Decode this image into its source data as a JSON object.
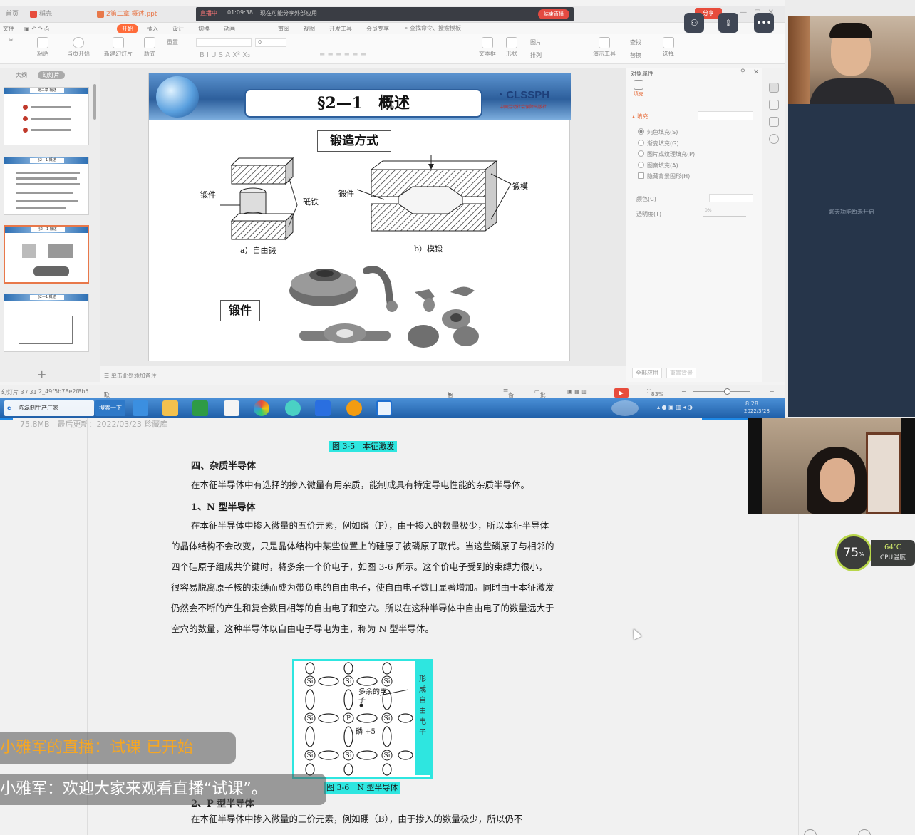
{
  "wps": {
    "tabs": [
      {
        "label": "首页"
      },
      {
        "label": "稻壳"
      },
      {
        "label": "2第二章 概述.ppt"
      }
    ],
    "recording": {
      "status": "直播中",
      "time": "01:09:38",
      "msg": "现在可能分享外部应用",
      "end_label": "结束直播"
    },
    "share_label": "分享",
    "menus": [
      "文件",
      "开始",
      "插入",
      "设计",
      "切换",
      "动画",
      "审阅",
      "视图",
      "开发工具",
      "会员专享"
    ],
    "search_cmd": "查找命令、搜索模板",
    "ribbon": {
      "paste": "粘贴",
      "from_start": "当页开始",
      "new_slide": "新建幻灯片",
      "layout": "版式",
      "reset": "重置",
      "font_size": "0",
      "textbox": "文本框",
      "shape": "形状",
      "arrange": "排列",
      "picture": "图片",
      "find": "查找",
      "replace": "替换",
      "select": "选择",
      "present_tools": "演示工具"
    },
    "thumb_tabs": {
      "outline": "大纲",
      "slides": "幻灯片"
    },
    "thumb_titles": [
      "第二章 概述",
      "§2—1 概述",
      "§2—1 概述",
      "§2—1 概述"
    ],
    "add_slide": "+",
    "slide": {
      "title": "§2—1　概述",
      "logo": "CLSSPH",
      "logo_sub": "中国劳动社会保障出版社",
      "forge_method": "锻造方式",
      "forging_box": "锻件",
      "label_forging_left": "锻件",
      "label_anvil": "砥铁",
      "label_forging_right": "锻件",
      "label_die": "锻模",
      "caption_a": "a）自由锻",
      "caption_b": "b）模锻"
    },
    "notes_hint": "单击此处添加备注",
    "props": {
      "title": "对象属性",
      "fill_tab": "填充",
      "fill_head": "填充",
      "options": [
        "纯色填充(S)",
        "渐变填充(G)",
        "图片或纹理填充(P)",
        "图案填充(A)",
        "隐藏背景图形(H)"
      ],
      "color_label": "颜色(C)",
      "transparency_label": "透明度(T)",
      "transparency_value": "0%",
      "apply_all": "全部应用",
      "reset_bg": "重置背景"
    },
    "status": {
      "slide_no": "幻灯片 3 / 31",
      "file_id": "2_49f5b78e2f8b5",
      "missing_font": "缺失字体",
      "beautify": "智能美化",
      "notes": "备注",
      "comments": "批注",
      "zoom": "83%",
      "zoom_fraction": 0.6
    },
    "taskbar": {
      "app1": "陈磊制生产厂家",
      "search": "搜索一下",
      "time": "8:28",
      "date": "2022/3/28"
    },
    "chat_disabled": "聊天功能暂未开启",
    "doc": {
      "meta": "75.8MB　最后更新：2022/03/23 珍藏库",
      "fig35": "图 3-5　本征激发",
      "h4": "四、杂质半导体",
      "p1": "在本征半导体中有选择的掺入微量有用杂质，能制成具有特定导电性能的杂质半导体。",
      "h41": "1、N 型半导体",
      "p2": "在本征半导体中掺入微量的五价元素，例如磷（P），由于掺入的数量极少，所以本征半导体的晶体结构不会改变，只是晶体结构中某些位置上的硅原子被磷原子取代。当这些磷原子与相邻的四个硅原子组成共价键时，将多余一个价电子，如图 3-6 所示。这个价电子受到的束缚力很小，很容易脱离原子核的束缚而成为带负电的自由电子，使自由电子数目显著增加。同时由于本征激发仍然会不断的产生和复合数目相等的自由电子和空穴。所以在这种半导体中自由电子的数量远大于空穴的数量，这种半导体以自由电子导电为主，称为 N 型半导体。",
      "fig36": "图 3-6　N 型半导体",
      "h42": "2、P 型半导体",
      "p3": "在本征半导体中掺入微量的三价元素，例如硼（B），由于掺入的数量极少，所以仍不",
      "fig_extra": "多余的电子",
      "fig_p": "磷 +5",
      "fig_side": "形成自由电子"
    },
    "cpu": {
      "usage": "75",
      "pct": "%",
      "temp": "64℃",
      "label": "CPU温度"
    },
    "live": {
      "start": "小雅军的直播：试课 已开始",
      "welcome": "小雅军：欢迎大家来观看直播“试课”。"
    }
  }
}
